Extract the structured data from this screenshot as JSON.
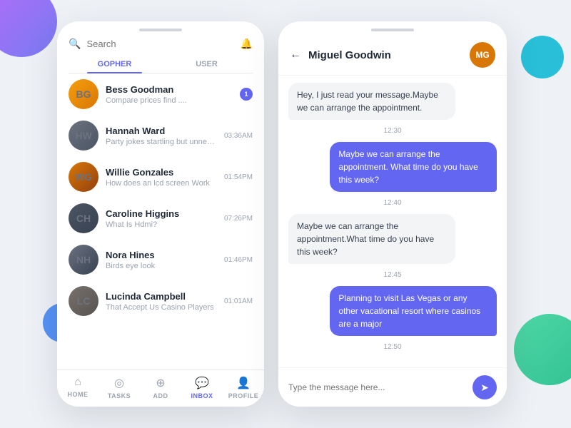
{
  "background": {
    "color": "#eef2f7"
  },
  "left_phone": {
    "search": {
      "placeholder": "Search"
    },
    "tabs": [
      {
        "id": "gopher",
        "label": "GOPHER",
        "active": true
      },
      {
        "id": "user",
        "label": "USER",
        "active": false
      }
    ],
    "messages": [
      {
        "id": 1,
        "name": "Bess Goodman",
        "preview": "Compare prices find ....",
        "time": "",
        "badge": "1",
        "initials": "BG",
        "av_class": "av-bess"
      },
      {
        "id": 2,
        "name": "Hannah Ward",
        "preview": "Party jokes startling but unnecessary",
        "time": "03:36AM",
        "badge": "",
        "initials": "HW",
        "av_class": "av-hannah"
      },
      {
        "id": 3,
        "name": "Willie Gonzales",
        "preview": "How does an lcd screen Work",
        "time": "01:54PM",
        "badge": "",
        "initials": "WG",
        "av_class": "av-willie"
      },
      {
        "id": 4,
        "name": "Caroline Higgins",
        "preview": "What Is Hdmi?",
        "time": "07:26PM",
        "badge": "",
        "initials": "CH",
        "av_class": "av-caroline"
      },
      {
        "id": 5,
        "name": "Nora Hines",
        "preview": "Birds eye look",
        "time": "01:46PM",
        "badge": "",
        "initials": "NH",
        "av_class": "av-nora"
      },
      {
        "id": 6,
        "name": "Lucinda Campbell",
        "preview": "That Accept Us Casino Players",
        "time": "01:01AM",
        "badge": "",
        "initials": "LC",
        "av_class": "av-lucinda"
      }
    ],
    "bottom_nav": [
      {
        "id": "home",
        "label": "HOME",
        "icon": "⌂",
        "active": false
      },
      {
        "id": "tasks",
        "label": "TASKS",
        "icon": "◎",
        "active": false
      },
      {
        "id": "add",
        "label": "ADD",
        "icon": "⊕",
        "active": false
      },
      {
        "id": "inbox",
        "label": "INBOX",
        "icon": "💬",
        "active": true
      },
      {
        "id": "profile",
        "label": "PROFILE",
        "icon": "👤",
        "active": false
      }
    ]
  },
  "right_phone": {
    "header": {
      "contact_name": "Miguel Goodwin",
      "contact_initials": "MG"
    },
    "messages": [
      {
        "type": "received",
        "text": "Hey, I just read your message.Maybe we can arrange the appointment.",
        "time": ""
      },
      {
        "type": "time",
        "text": "12:30"
      },
      {
        "type": "sent",
        "text": "Maybe we can arrange the appointment. What time do you have this week?",
        "time": ""
      },
      {
        "type": "time",
        "text": "12:40"
      },
      {
        "type": "received",
        "text": "Maybe we can arrange the appointment.What time do you have this week?",
        "time": ""
      },
      {
        "type": "time",
        "text": "12:45"
      },
      {
        "type": "sent",
        "text": "Planning to visit Las Vegas or any other vacational resort where casinos are a major",
        "time": ""
      },
      {
        "type": "time",
        "text": "12:50"
      }
    ],
    "input": {
      "placeholder": "Type the message here..."
    }
  }
}
